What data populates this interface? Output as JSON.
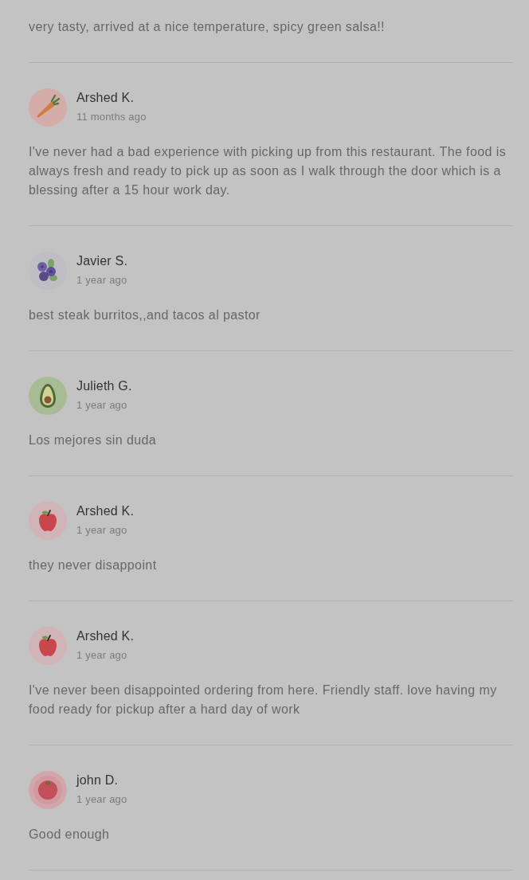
{
  "reviews": [
    {
      "body": "very tasty, arrived at a nice temperature, spicy green salsa!!"
    },
    {
      "author": "Arshed K.",
      "time": "11 months ago",
      "kind": "carrot",
      "body": "I've never had a bad experience with picking up from this restaurant. The food is always fresh and ready to pick up as soon as I walk through the door which is a blessing after a 15 hour work day."
    },
    {
      "author": "Javier S.",
      "time": "1 year ago",
      "kind": "blueberries",
      "body": "best steak burritos,,and tacos al pastor"
    },
    {
      "author": "Julieth G.",
      "time": "1 year ago",
      "kind": "avocado",
      "body": "Los mejores sin duda"
    },
    {
      "author": "Arshed K.",
      "time": "1 year ago",
      "kind": "apple",
      "body": "they never disappoint"
    },
    {
      "author": "Arshed K.",
      "time": "1 year ago",
      "kind": "apple",
      "body": "I've never been disappointed ordering from here. Friendly staff. love having my food ready for pickup after a hard day of work"
    },
    {
      "author": "john D.",
      "time": "1 year ago",
      "kind": "tomato",
      "body": "Good enough"
    }
  ]
}
